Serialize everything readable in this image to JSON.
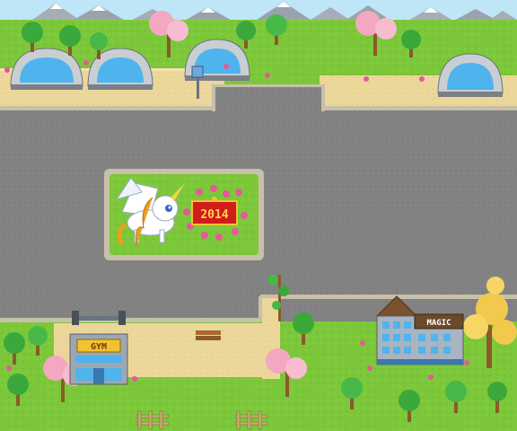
{
  "scene": {
    "banner_year": "2014",
    "gym_sign": "GYM",
    "magic_sign": "MAGIC"
  },
  "colors": {
    "grass": "#7cc83a",
    "grass_dark": "#5fae2a",
    "road": "#808080",
    "road_edge": "#c8c0a8",
    "sand": "#ecd79a",
    "sky": "#bfe6f6",
    "mountain": "#9aa3ad",
    "dome": "#c9ced3",
    "dome_glass": "#4fb3ee",
    "banner_red": "#d21c1c",
    "banner_gold": "#f2c230",
    "sakura": "#f4a7c0",
    "gold_tree": "#f2c94c"
  }
}
